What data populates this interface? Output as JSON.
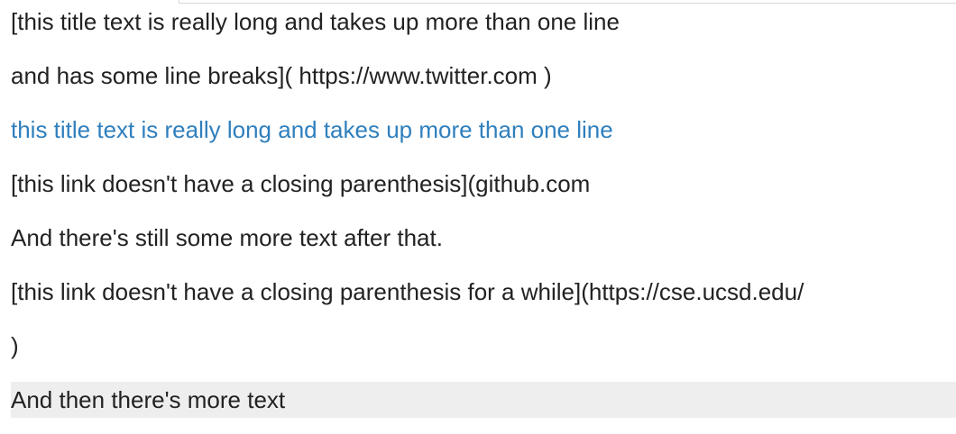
{
  "content": {
    "lines": [
      "[this title text is really long and takes up more than one line",
      "and has some line breaks]( https://www.twitter.com )",
      "this title text is really long and takes up more than one line",
      "[this link doesn't have a closing parenthesis](github.com",
      "And there's still some more text after that.",
      "[this link doesn't have a closing parenthesis for a while](https://cse.ucsd.edu/",
      ")",
      "And then there's more text"
    ]
  },
  "colors": {
    "link": "#2f7fbd",
    "text": "#222222",
    "highlight_row": "#eeeeee"
  }
}
